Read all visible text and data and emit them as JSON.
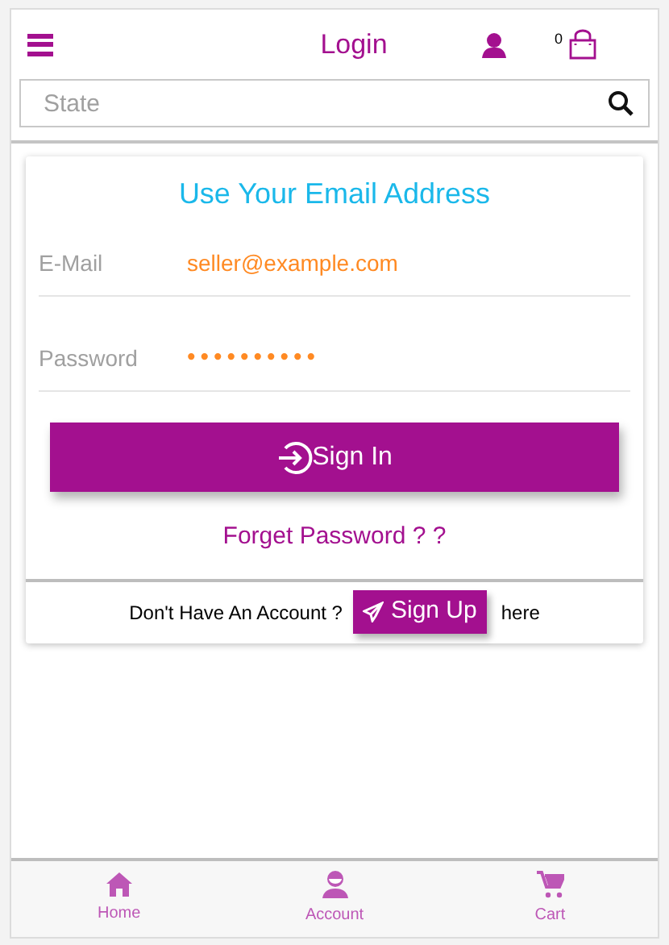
{
  "header": {
    "title": "Login",
    "cart_count": "0"
  },
  "search": {
    "placeholder": "State"
  },
  "card": {
    "heading": "Use Your Email Address",
    "fields": [
      {
        "label": "E-Mail",
        "value": "seller@example.com"
      },
      {
        "label": "Password",
        "value": "••••••••••"
      }
    ],
    "sign_in": "Sign In",
    "forget": "Forget Password ? ?"
  },
  "signup_row": {
    "prefix": "Don't Have An Account ?",
    "button": "Sign Up",
    "suffix": "here"
  },
  "bottom_nav": [
    {
      "kind": "home",
      "label": "Home"
    },
    {
      "kind": "account",
      "label": "Account"
    },
    {
      "kind": "cart",
      "label": "Cart"
    }
  ]
}
